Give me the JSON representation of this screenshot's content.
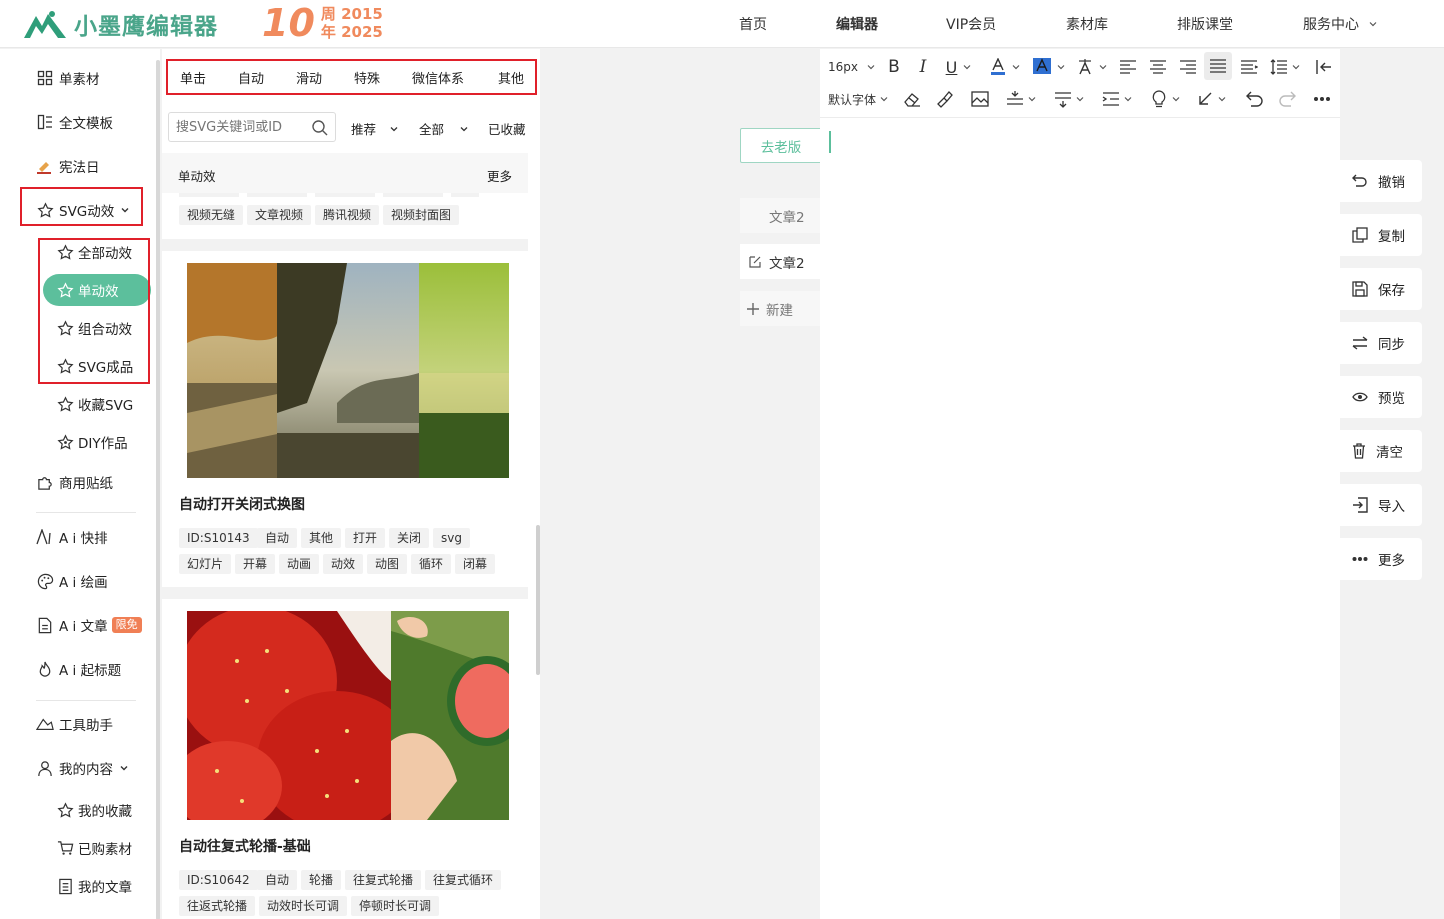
{
  "header": {
    "logo_text": "小墨鹰编辑器",
    "anniversary": {
      "number": "10",
      "line1": "周 2015",
      "line2": "年 2025"
    },
    "nav": [
      {
        "label": "首页",
        "active": false
      },
      {
        "label": "编辑器",
        "active": true
      },
      {
        "label": "VIP会员",
        "active": false
      },
      {
        "label": "素材库",
        "active": false
      },
      {
        "label": "排版课堂",
        "active": false
      },
      {
        "label": "服务中心",
        "active": false
      }
    ]
  },
  "sidebar": {
    "items": [
      {
        "label": "单素材",
        "icon": "grid-icon"
      },
      {
        "label": "全文模板",
        "icon": "layout-icon"
      },
      {
        "label": "宪法日",
        "icon": "gavel-icon"
      },
      {
        "label": "SVG动效",
        "icon": "star-outline-icon"
      }
    ],
    "svg_sub": [
      {
        "label": "全部动效",
        "active": false
      },
      {
        "label": "单动效",
        "active": true
      },
      {
        "label": "组合动效",
        "active": false
      },
      {
        "label": "SVG成品",
        "active": false
      },
      {
        "label": "收藏SVG",
        "active": false
      },
      {
        "label": "DIY作品",
        "active": false
      }
    ],
    "sticker": "商用贴纸",
    "ai": [
      {
        "label": "A i 快排",
        "icon": "ai-icon"
      },
      {
        "label": "A i 绘画",
        "icon": "palette-icon"
      },
      {
        "label": "A i 文章",
        "icon": "doc-icon",
        "badge": "限免"
      },
      {
        "label": "A i 起标题",
        "icon": "fire-icon"
      }
    ],
    "tools": "工具助手",
    "my_content": "我的内容",
    "my_sub": [
      "我的收藏",
      "已购素材",
      "我的文章"
    ]
  },
  "panel": {
    "tabs": [
      "单击",
      "自动",
      "滑动",
      "特殊",
      "微信体系",
      "其他"
    ],
    "search_placeholder": "搜SVG关键词或ID",
    "filters": {
      "sort": "推荐",
      "range": "全部",
      "collected": "已收藏"
    },
    "section": {
      "title": "单动效",
      "more": "更多"
    },
    "top_tags": [
      "视频无缝",
      "文章视频",
      "腾讯视频",
      "视频封面图"
    ],
    "cards": [
      {
        "title": "自动打开关闭式换图",
        "tags_row1": [
          "ID:S10143",
          "自动",
          "其他",
          "打开",
          "关闭",
          "svg"
        ],
        "tags_row2": [
          "幻灯片",
          "开幕",
          "动画",
          "动效",
          "动图",
          "循环",
          "闭幕"
        ]
      },
      {
        "title": "自动往复式轮播-基础",
        "tags_row1": [
          "ID:S10642",
          "自动",
          "轮播",
          "往复式轮播",
          "往复式循环"
        ],
        "tags_row2": [
          "往返式轮播",
          "动效时长可调",
          "停顿时长可调"
        ]
      }
    ]
  },
  "middle": {
    "old_version": "去老版",
    "articles": [
      "文章2",
      "文章2"
    ],
    "new_label": "新建"
  },
  "editor": {
    "font_size": "16px",
    "font_family": "默认字体"
  },
  "right_actions": [
    "撤销",
    "复制",
    "保存",
    "同步",
    "预览",
    "清空",
    "导入",
    "更多"
  ],
  "colors": {
    "accent": "#5cbf9c",
    "highlight_box": "#e0202a",
    "brand": "#4aa58a",
    "anniversary": "#f08a5d"
  }
}
